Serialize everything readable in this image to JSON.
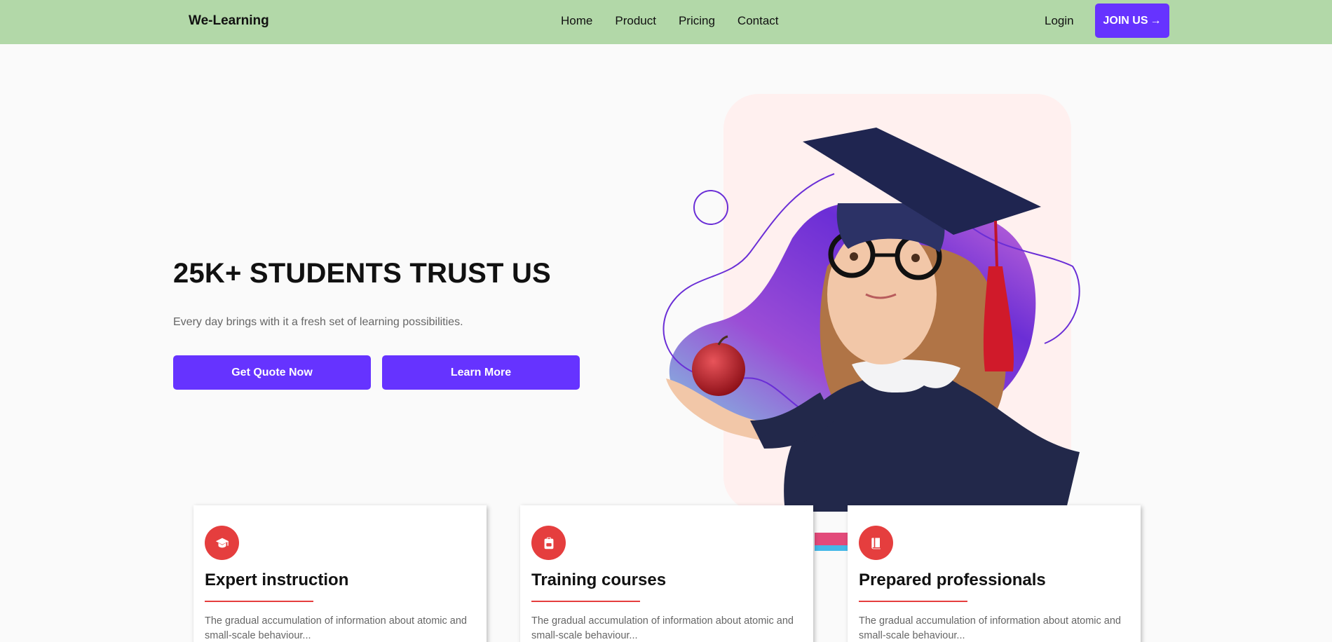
{
  "nav": {
    "brand": "We-Learning",
    "links": [
      "Home",
      "Product",
      "Pricing",
      "Contact"
    ],
    "login": "Login",
    "join": "JOIN US",
    "join_arrow": "→"
  },
  "hero": {
    "title": "25K+ STUDENTS TRUST US",
    "subtitle": "Every day brings with it a fresh set of learning possibilities.",
    "btn_quote": "Get Quote Now",
    "btn_learn": "Learn More"
  },
  "features": [
    {
      "icon": "graduation-cap-icon",
      "title": "Expert instruction",
      "desc": "The gradual accumulation of information about atomic and small-scale behaviour..."
    },
    {
      "icon": "backpack-icon",
      "title": "Training courses",
      "desc": "The gradual accumulation of information about atomic and small-scale behaviour..."
    },
    {
      "icon": "book-icon",
      "title": "Prepared professionals",
      "desc": "The gradual accumulation of information about atomic and small-scale behaviour..."
    }
  ],
  "colors": {
    "nav_bg": "#b2d8a8",
    "accent": "#6633ff",
    "feature_red": "#e53e3e",
    "page_bg": "#fafafa"
  }
}
